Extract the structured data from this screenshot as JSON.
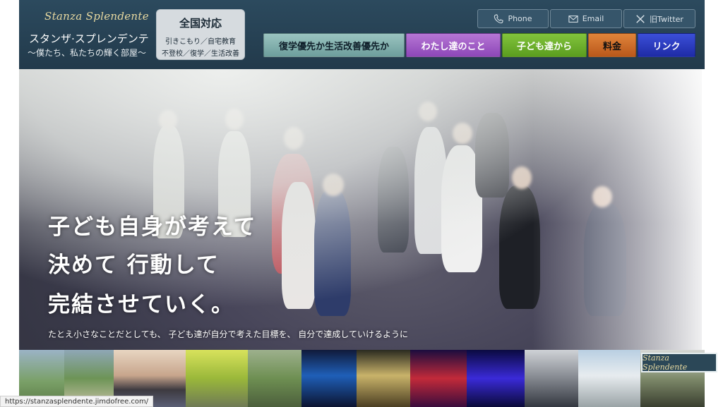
{
  "header": {
    "logo_script": "Stanza Splendente",
    "logo_jp": "スタンザ·スプレンデンテ",
    "logo_sub": "〜僕たち、私たちの輝く部屋〜",
    "badge": {
      "title": "全国対応",
      "line1": "引きこもり／自宅教育",
      "line2": "不登校／復学／生活改善"
    },
    "sns": {
      "phone_label": "Phone",
      "email_label": "Email",
      "twitter_label": "旧Twitter"
    },
    "nav": [
      {
        "label": "復学優先か生活改善優先か",
        "color": "#7fb1ae"
      },
      {
        "label": "わたし達のこと",
        "color": "#a25fc8"
      },
      {
        "label": "子ども達から",
        "color": "#6cb12e"
      },
      {
        "label": "料金",
        "color": "#cc6b2a"
      },
      {
        "label": "リンク",
        "color": "#2a3ac0"
      }
    ]
  },
  "hero": {
    "line1": "子ども自身が考えて",
    "line2": "決めて 行動して",
    "line3": "完結させていく。",
    "caption": "たとえ小さなことだとしても、 子ども達が自分で考えた目標を、 自分で達成していけるように"
  },
  "thumbnail_logo": "Stanza Splendente",
  "status_url": "https://stanzasplendente.jimdofree.com/"
}
